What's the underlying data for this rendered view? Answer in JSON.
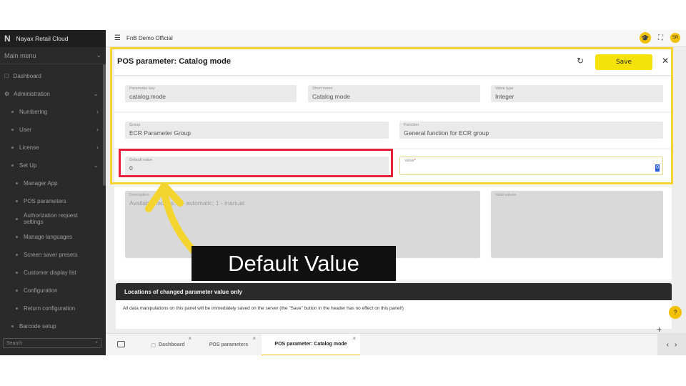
{
  "sidebar": {
    "brand": "Nayax Retail Cloud",
    "menu_head": "Main menu",
    "items": [
      {
        "label": "Dashboard"
      },
      {
        "label": "Administration"
      },
      {
        "label": "Numbering"
      },
      {
        "label": "User"
      },
      {
        "label": "License"
      },
      {
        "label": "Set Up"
      },
      {
        "label": "Manager App"
      },
      {
        "label": "POS parameters"
      },
      {
        "label": "Authorization request settings"
      },
      {
        "label": "Manage languages"
      },
      {
        "label": "Screen saver presets"
      },
      {
        "label": "Customer display list"
      },
      {
        "label": "Configuration"
      },
      {
        "label": "Return configuration"
      },
      {
        "label": "Barcode setup"
      }
    ],
    "search_placeholder": "Search"
  },
  "topbar": {
    "title": "FnB Demo Official",
    "avatar": "SR"
  },
  "panel": {
    "title": "POS parameter: Catalog mode",
    "save_label": "Save",
    "fields": {
      "parameter_key": {
        "label": "Parameter key",
        "value": "catalog.mode"
      },
      "short_name": {
        "label": "Short name",
        "value": "Catalog mode"
      },
      "value_type": {
        "label": "Value type",
        "value": "Integer"
      },
      "group": {
        "label": "Group",
        "value": "ECR Parameter Group"
      },
      "function": {
        "label": "Function",
        "value": "General function for ECR group"
      },
      "default_value": {
        "label": "Default value",
        "value": "0"
      },
      "value": {
        "label": "Value",
        "required_mark": "*",
        "value": "0"
      },
      "description": {
        "label": "Description",
        "value": "Available modes: 0 - automatic; 1 - manual"
      },
      "valid_values": {
        "label": "Valid values"
      }
    }
  },
  "locations": {
    "title": "Locations of changed parameter value only",
    "note": "All data manipulations on this panel will be immediately saved on the server (the \"Save\" button in the header has no effect on this panel!)"
  },
  "tabs": [
    {
      "label": "Dashboard"
    },
    {
      "label": "POS parameters"
    },
    {
      "label": "POS parameter: Catalog mode"
    }
  ],
  "annotation": {
    "callout": "Default Value",
    "frame_color": "#f4d530",
    "highlight_color": "#e8203a"
  },
  "colors": {
    "accent": "#f5e20a",
    "sidebar_bg": "#2a2a2a",
    "header_dark": "#2b2b2b"
  }
}
